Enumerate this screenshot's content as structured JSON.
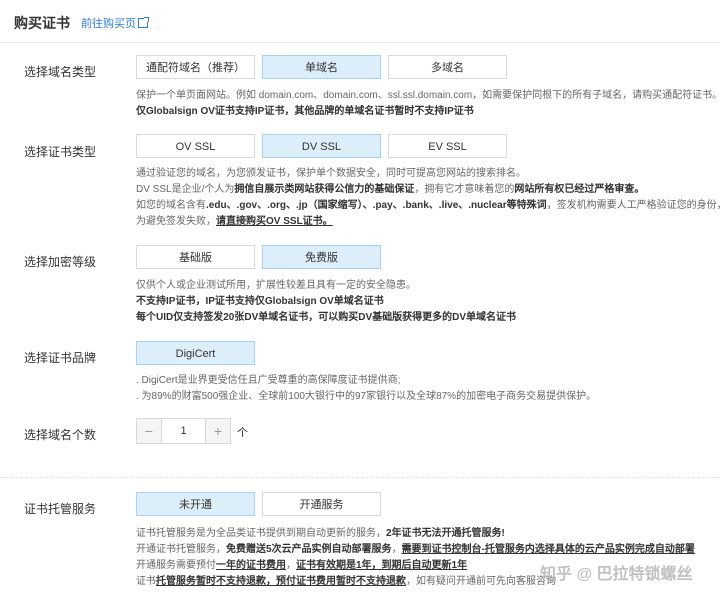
{
  "header": {
    "title": "购买证书",
    "buy_link": "前往购买页"
  },
  "domain_type": {
    "label": "选择域名类型",
    "options": [
      "通配符域名（推荐）",
      "单域名",
      "多域名"
    ],
    "desc": [
      "保护一个单页面网站。例如 domain.com、domain.com、ssl.ssl.domain.com，如需要保护同根下的所有子域名，请购买通配符证书。",
      "仅Globalsign OV证书支持IP证书，其他品牌的单域名证书暂时不支持IP证书"
    ]
  },
  "cert_type": {
    "label": "选择证书类型",
    "options": [
      "OV SSL",
      "DV SSL",
      "EV SSL"
    ],
    "desc1": "通过验证您的域名，为您颁发证书，保护单个数据安全，同时可提高您网站的搜索排名。",
    "desc2a": "DV SSL是企业/个人为",
    "desc2b": "拥信自展示类网站获得公信力的基础保证",
    "desc2c": "，拥有它才意味着您的",
    "desc2d": "网站所有权已经过严格审查。",
    "desc3a": "如您的域名含有",
    "desc3b": ".edu、.gov、.org、.jp（国家缩写）、.pay、.bank、.live、.nuclear等特殊词",
    "desc3c": "，签发机构需要人工严格验证您的身份，",
    "desc4a": "为避免签发失败，",
    "desc4b": "请直接购买OV SSL证书。"
  },
  "encrypt_level": {
    "label": "选择加密等级",
    "options": [
      "基础版",
      "免费版"
    ],
    "desc": [
      "仅供个人或企业测试所用，扩展性较差且具有一定的安全隐患。",
      "不支持IP证书，IP证书支持仅Globalsign OV单域名证书",
      "每个UID仅支持签发20张DV单域名证书，可以购买DV基础版获得更多的DV单域名证书"
    ]
  },
  "brand": {
    "label": "选择证书品牌",
    "option": "DigiCert",
    "desc": [
      ". DigiCert是业界更受信任且广受尊重的高保障度证书提供商;",
      ". 为89%的财富500强企业、全球前100大银行中的97家银行以及全球87%的加密电子商务交易提供保护。"
    ]
  },
  "domain_count": {
    "label": "选择域名个数",
    "minus": "−",
    "value": "1",
    "plus": "+",
    "unit": "个"
  },
  "hosting": {
    "label": "证书托管服务",
    "options": [
      "未开通",
      "开通服务"
    ],
    "l1a": "证书托管服务是为全品类证书提供到期自动更新的服务，",
    "l1b": "2年证书无法开通托管服务!",
    "l2a": "开通证书托管服务，",
    "l2b": "免费赠送5次云产品实例自动部署服务",
    "l2c": "，",
    "l2d": "需要到证书控制台-托管服务内选择具体的云产品实例完成自动部署",
    "l3a": "开通服务需要预付",
    "l3b": "一年的证书费用",
    "l3c": "，",
    "l3d": "证书有效期是1年，到期后自动更新1年",
    "l4a": "证书",
    "l4b": "托管服务暂时不支持退款，预付证书费用暂时不支持退款",
    "l4c": "，如有疑问开通前可先向客服咨询"
  },
  "watermark": {
    "text": "知乎 @ 巴拉特锁螺丝"
  }
}
